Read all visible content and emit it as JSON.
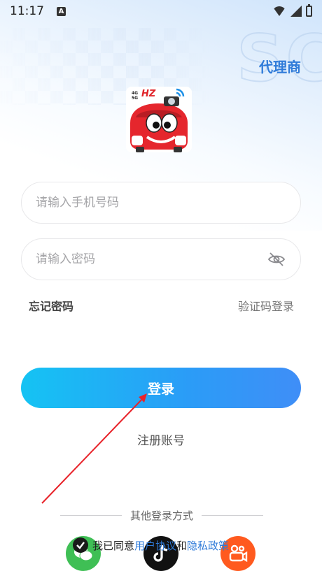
{
  "status": {
    "time": "11:17",
    "notification_badge": "A"
  },
  "header": {
    "agent_link": "代理商"
  },
  "logo": {
    "brand_text": "HZ",
    "badge_top": "4G",
    "badge_bottom": "5G"
  },
  "form": {
    "phone_placeholder": "请输入手机号码",
    "password_placeholder": "请输入密码",
    "forgot_password": "忘记密码",
    "sms_login": "验证码登录",
    "login_label": "登录",
    "register_label": "注册账号"
  },
  "other_login": {
    "title": "其他登录方式"
  },
  "agreement": {
    "prefix": "我已同意",
    "user_agreement": "用户协议",
    "and": "和",
    "privacy_policy": "隐私政策"
  },
  "colors": {
    "accent": "#2f7bd9",
    "button_start": "#15c3f3",
    "button_end": "#3f8ef7"
  }
}
